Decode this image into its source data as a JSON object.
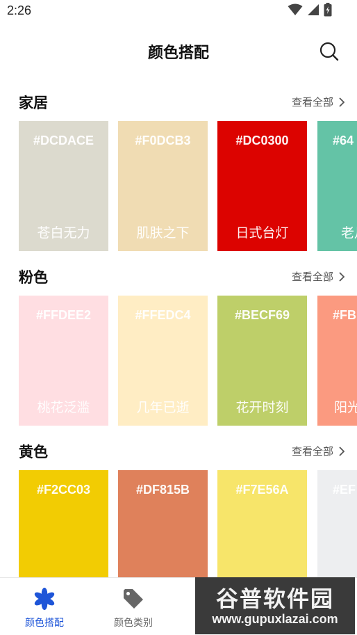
{
  "status_bar": {
    "time": "2:26"
  },
  "app_bar": {
    "title": "颜色搭配"
  },
  "sections": [
    {
      "title": "家居",
      "more_label": "查看全部",
      "cards": [
        {
          "hex": "#DCDACE",
          "name": "苍白无力",
          "color": "#DCDACE"
        },
        {
          "hex": "#F0DCB3",
          "name": "肌肤之下",
          "color": "#F0DCB3"
        },
        {
          "hex": "#DC0300",
          "name": "日式台灯",
          "color": "#DC0300"
        },
        {
          "hex": "#64",
          "name": "老月",
          "color": "#64C3A6"
        }
      ]
    },
    {
      "title": "粉色",
      "more_label": "查看全部",
      "cards": [
        {
          "hex": "#FFDEE2",
          "name": "桃花泛滥",
          "color": "#FFDEE2"
        },
        {
          "hex": "#FFEDC4",
          "name": "几年已逝",
          "color": "#FFEDC4"
        },
        {
          "hex": "#BECF69",
          "name": "花开时刻",
          "color": "#BECF69"
        },
        {
          "hex": "#FB",
          "name": "阳光",
          "color": "#FB9A80"
        }
      ]
    },
    {
      "title": "黄色",
      "more_label": "查看全部",
      "cards": [
        {
          "hex": "#F2CC03",
          "name": "",
          "color": "#F2CC03"
        },
        {
          "hex": "#DF815B",
          "name": "",
          "color": "#DF815B"
        },
        {
          "hex": "#F7E56A",
          "name": "",
          "color": "#F7E56A"
        },
        {
          "hex": "#EF",
          "name": "",
          "color": "#EDEEF0"
        }
      ]
    }
  ],
  "tab_bar": {
    "tabs": [
      {
        "label": "颜色搭配",
        "active": true,
        "icon": "flower-icon"
      },
      {
        "label": "颜色类别",
        "active": false,
        "icon": "tag-icon"
      }
    ],
    "active_color": "#1E55D8",
    "inactive_color": "#666666"
  },
  "watermark": {
    "line1": "谷普软件园",
    "line2": "www.gupuxlazai.com"
  }
}
